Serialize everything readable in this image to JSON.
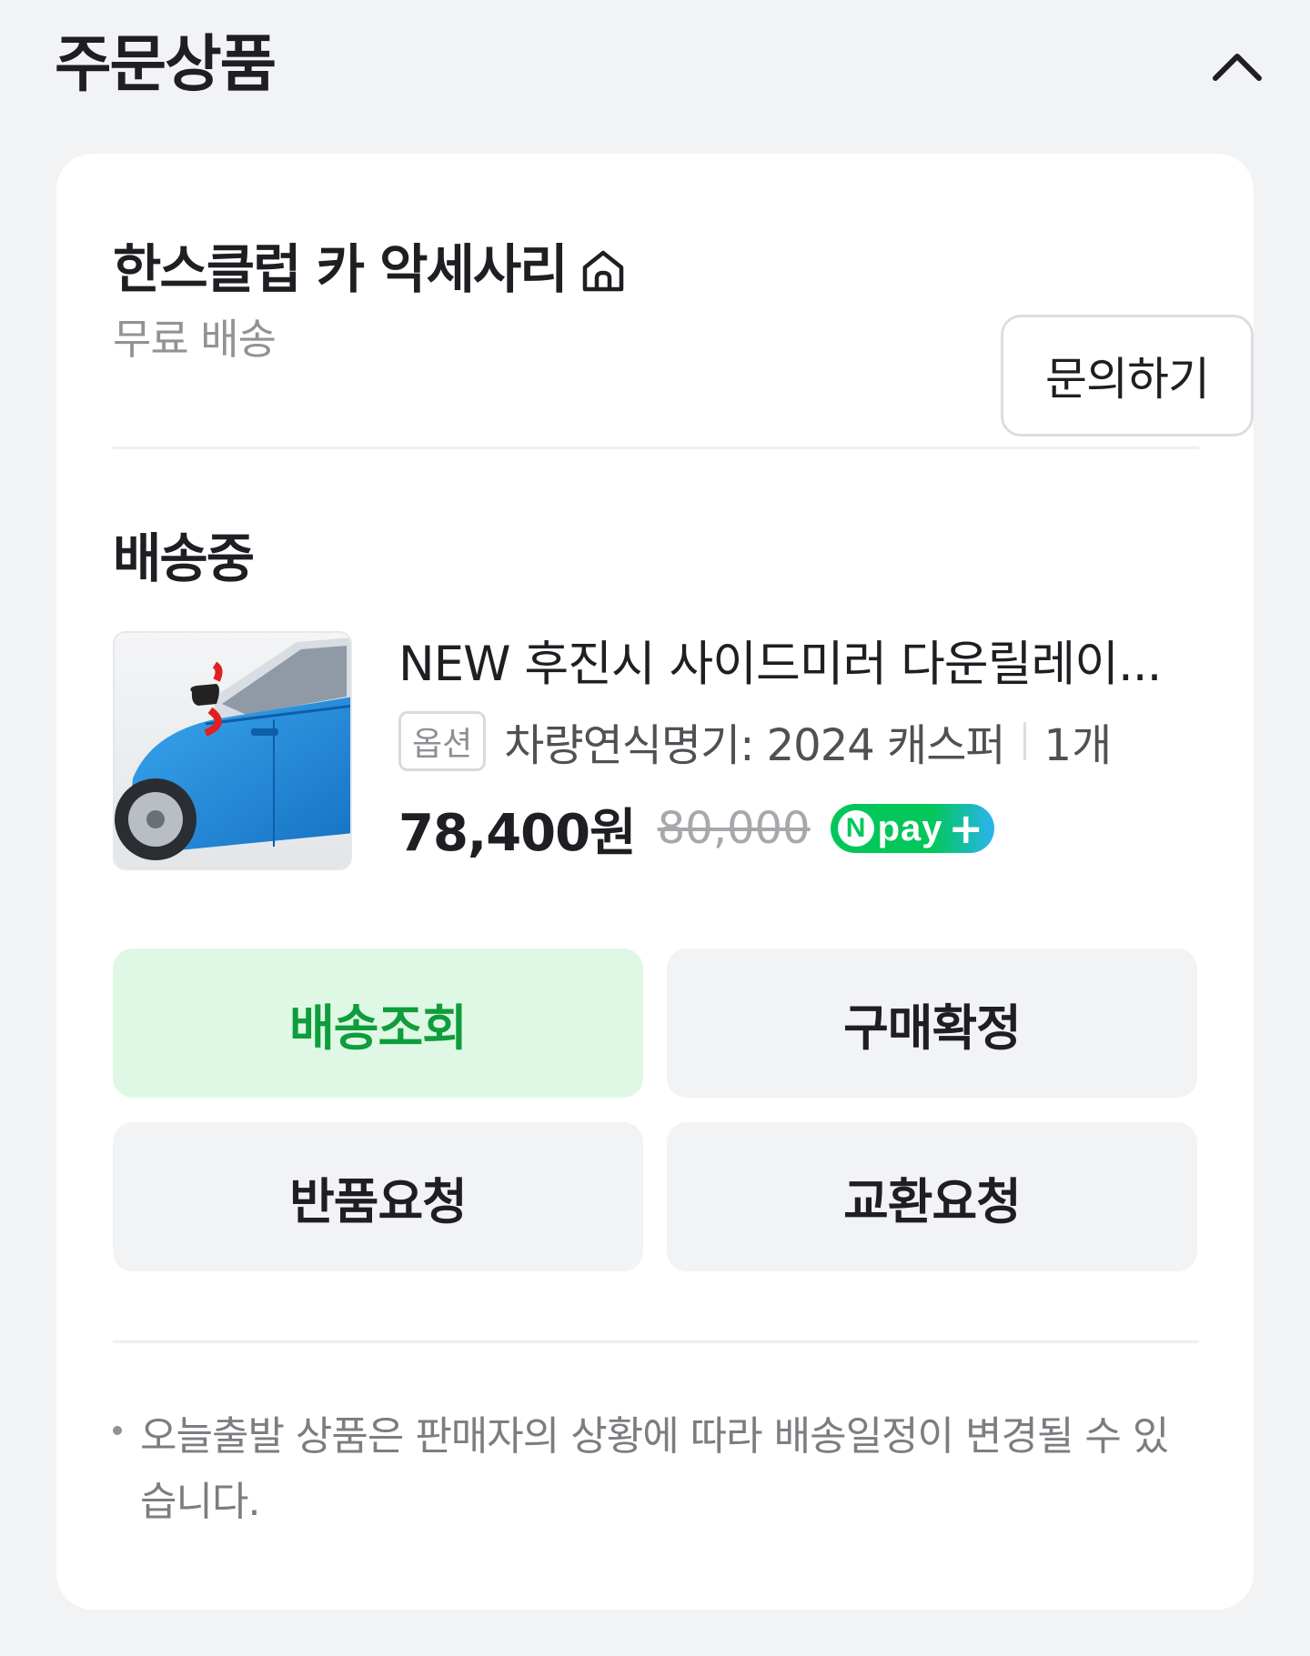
{
  "section": {
    "title": "주문상품",
    "collapse_icon": "chevron-up-icon"
  },
  "store": {
    "name": "한스클럽 카 악세사리",
    "home_icon": "home-icon",
    "shipping": "무료 배송",
    "inquiry_label": "문의하기"
  },
  "order": {
    "status": "배송중",
    "product": {
      "name": "NEW 후진시 사이드미러 다운릴레이...",
      "option_badge": "옵션",
      "option_text": "차량연식명기: 2024 캐스퍼",
      "quantity": "1개",
      "price": "78,400원",
      "original_price": "80,000",
      "npay_n": "N",
      "npay_word": "pay",
      "npay_plus": "+",
      "thumbnail_icon": "blue-car-side-mirror-image"
    },
    "actions": {
      "track": "배송조회",
      "confirm": "구매확정",
      "return": "반품요청",
      "exchange": "교환요청"
    }
  },
  "notice": {
    "text": "오늘출발 상품은 판매자의 상황에 따라 배송일정이 변경될 수 있습니다."
  },
  "colors": {
    "background": "#f2f3f5",
    "card": "#ffffff",
    "accent_green": "#0f9d3c",
    "accent_green_bg": "#dff8e5",
    "npay_green": "#03c75a"
  }
}
